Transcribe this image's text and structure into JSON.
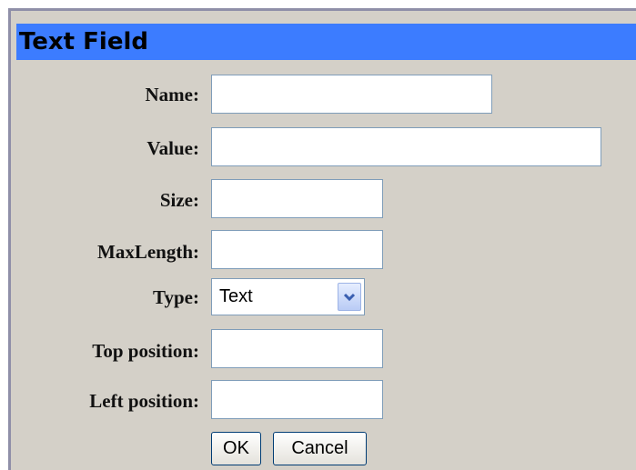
{
  "dialog": {
    "title": "Text Field"
  },
  "form": {
    "name_label": "Name:",
    "value_label": "Value:",
    "size_label": "Size:",
    "maxlength_label": "MaxLength:",
    "type_label": "Type:",
    "top_label": "Top position:",
    "left_label": "Left position:",
    "name_value": "",
    "value_value": "",
    "size_value": "",
    "maxlength_value": "",
    "type_selected": "Text",
    "top_value": "",
    "left_value": ""
  },
  "buttons": {
    "ok_label": "OK",
    "cancel_label": "Cancel"
  },
  "colors": {
    "titlebar": "#3c7cff",
    "dialog_bg": "#d4d0c8",
    "field_border": "#7f9db9"
  },
  "icons": {
    "dropdown": "chevron-down-icon"
  }
}
